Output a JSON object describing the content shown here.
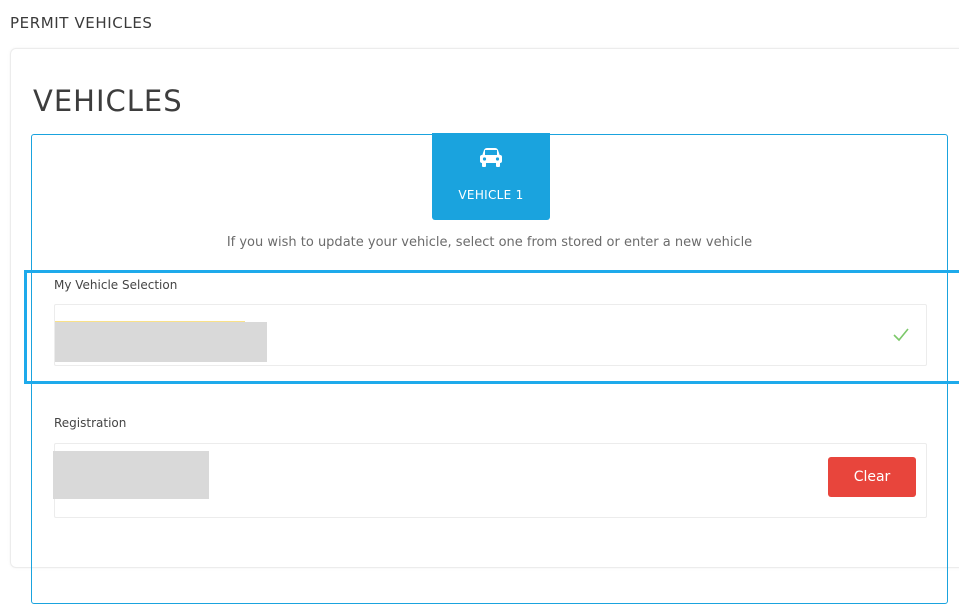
{
  "breadcrumb": "PERMIT VEHICLES",
  "page_title": "VEHICLES",
  "vehicle_tab": {
    "label": "VEHICLE 1",
    "icon": "car-icon"
  },
  "instruction": "If you wish to update your vehicle, select one from stored or enter a new vehicle",
  "vehicle_selection": {
    "label": "My Vehicle Selection",
    "value": "",
    "status_icon": "check-icon"
  },
  "registration": {
    "label": "Registration",
    "value": ""
  },
  "clear_button": "Clear",
  "colors": {
    "accent": "#1aa3de",
    "clear_button": "#e8453c",
    "check": "#7cc86a",
    "highlight": "#1eaaeb"
  }
}
